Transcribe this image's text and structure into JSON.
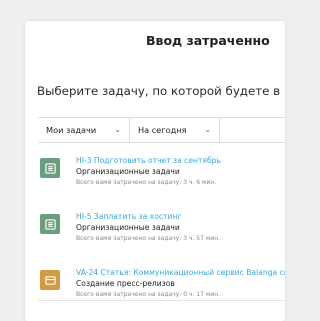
{
  "header": {
    "title": "Ввод затраченно"
  },
  "prompt": {
    "text": "Выберите задачу, по которой будете в"
  },
  "filters": {
    "scope": {
      "selected": "Мои задачи"
    },
    "period": {
      "selected": "На сегодня"
    },
    "search": {
      "value": ""
    }
  },
  "tasks": [
    {
      "name": "HI-3 Подготовить отчет за сентябрь",
      "group": "Организационные задачи",
      "spent": "Всего вами затрачено на задачу: 3 ч. 6 мин.",
      "icon": "task-list-icon",
      "color": "#6a9e7e"
    },
    {
      "name": "HI-5 Заплатить за хостинг",
      "group": "Организационные задачи",
      "spent": "Всего вами затрачено на задачу: 3 ч. 57 мин.",
      "icon": "task-list-icon",
      "color": "#6a9e7e"
    },
    {
      "name": "VA-24 Статья: Коммуникационный сервис Balanga сп",
      "group": "Создание пресс-релизов",
      "spent": "Всего вами затрачено на задачу: 0 ч. 17 мин.",
      "icon": "card-icon",
      "color": "#d39a3f"
    }
  ]
}
